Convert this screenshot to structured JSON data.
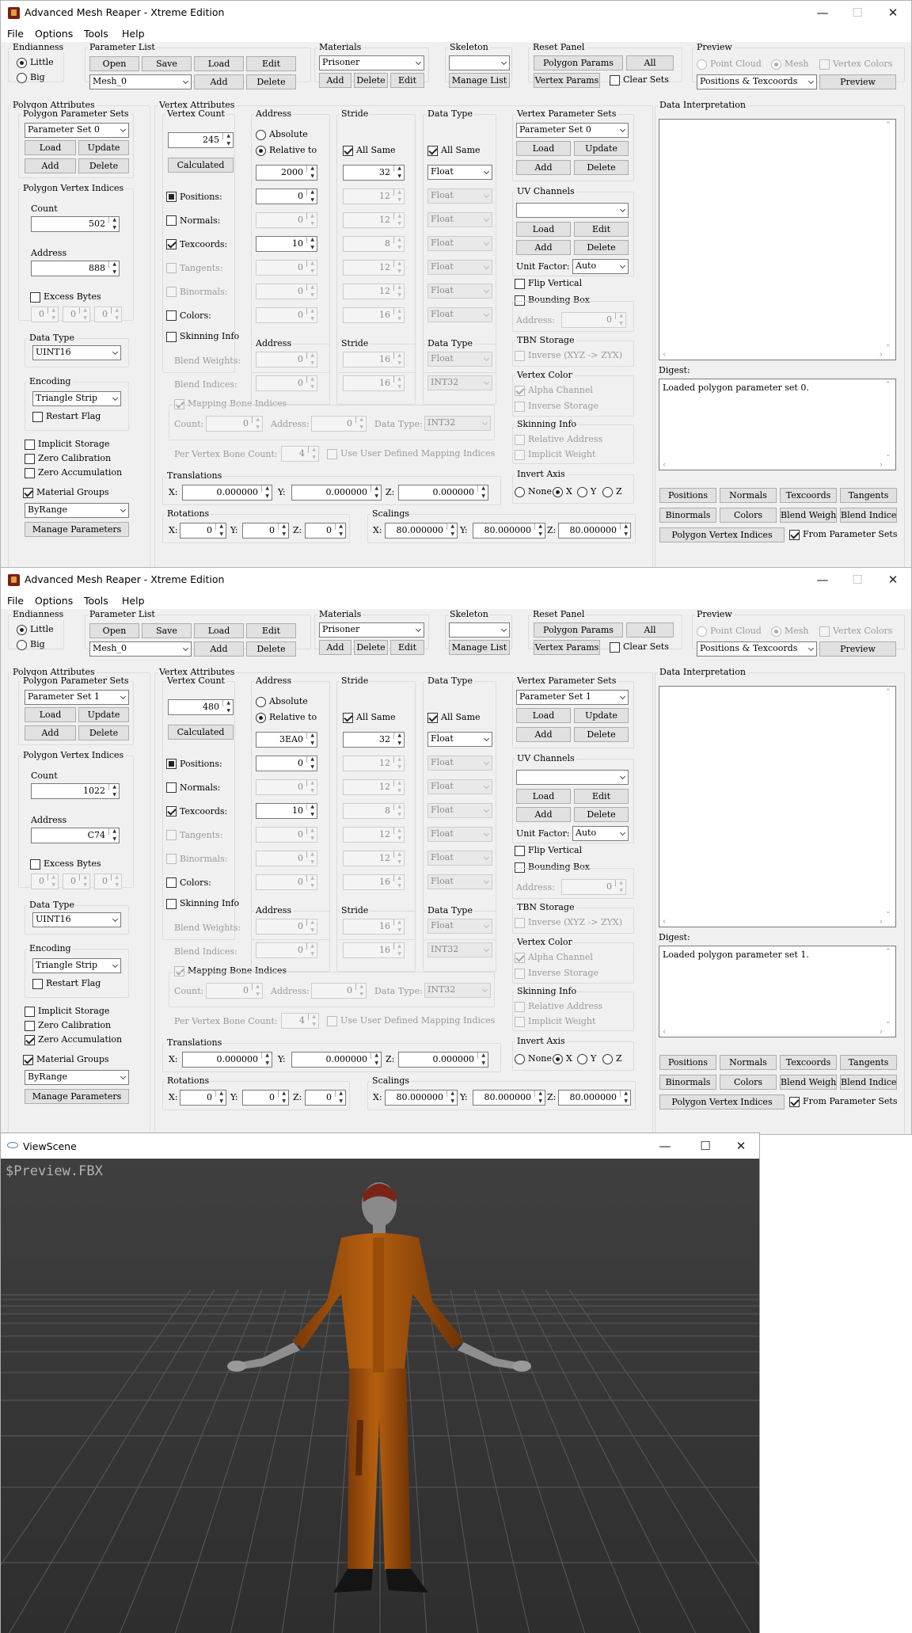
{
  "window1": {
    "title": "Advanced Mesh Reaper - Xtreme Edition",
    "menu": [
      "File",
      "Options",
      "Tools",
      "Help"
    ],
    "endianness": {
      "title": "Endianness",
      "little": "Little",
      "big": "Big"
    },
    "parameter_list": {
      "title": "Parameter List",
      "open": "Open",
      "save": "Save",
      "load": "Load",
      "edit": "Edit",
      "add": "Add",
      "delete": "Delete",
      "mesh": "Mesh_0"
    },
    "materials": {
      "title": "Materials",
      "value": "Prisoner",
      "add": "Add",
      "delete": "Delete",
      "edit": "Edit"
    },
    "skeleton": {
      "title": "Skeleton",
      "value": "",
      "manage": "Manage List"
    },
    "reset_panel": {
      "title": "Reset Panel",
      "polygon_params": "Polygon Params",
      "all": "All",
      "vertex_params": "Vertex Params",
      "clear_sets": "Clear Sets"
    },
    "preview": {
      "title": "Preview",
      "point_cloud": "Point Cloud",
      "mesh": "Mesh",
      "vertex_colors": "Vertex Colors",
      "mode": "Positions & Texcoords",
      "button": "Preview"
    },
    "polygon_attributes": {
      "title": "Polygon Attributes",
      "sets_title": "Polygon Parameter Sets",
      "set_value": "Parameter Set 0",
      "load": "Load",
      "update": "Update",
      "add": "Add",
      "delete": "Delete",
      "pvi_title": "Polygon Vertex Indices",
      "count_label": "Count",
      "count": "502",
      "address_label": "Address",
      "address": "888",
      "excess_bytes": "Excess Bytes",
      "excess": [
        "0",
        "0",
        "0"
      ],
      "data_type_title": "Data Type",
      "data_type": "UINT16",
      "encoding_title": "Encoding",
      "encoding": "Triangle Strip",
      "restart_flag": "Restart Flag",
      "implicit_storage": "Implicit Storage",
      "zero_calibration": "Zero Calibration",
      "zero_accumulation": "Zero Accumulation",
      "material_groups": "Material Groups",
      "group_mode": "ByRange",
      "manage": "Manage Parameters"
    },
    "vertex_attributes": {
      "title": "Vertex Attributes",
      "vertex_count_title": "Vertex Count",
      "vertex_count": "245",
      "calculated": "Calculated",
      "address_title": "Address",
      "absolute": "Absolute",
      "relative_to": "Relative to",
      "relative_value": "2000",
      "stride_title": "Stride",
      "all_same": "All Same",
      "stride_value": "32",
      "data_type_title": "Data Type",
      "data_type_value": "Float",
      "rows": [
        {
          "label": "Positions:",
          "address": "0",
          "stride": "12",
          "type": "Float"
        },
        {
          "label": "Normals:",
          "address": "0",
          "stride": "12",
          "type": "Float"
        },
        {
          "label": "Texcoords:",
          "address": "10",
          "stride": "8",
          "type": "Float"
        },
        {
          "label": "Tangents:",
          "address": "0",
          "stride": "12",
          "type": "Float"
        },
        {
          "label": "Binormals:",
          "address": "0",
          "stride": "12",
          "type": "Float"
        },
        {
          "label": "Colors:",
          "address": "0",
          "stride": "16",
          "type": "Float"
        }
      ],
      "skinning_info": "Skinning Info",
      "blend_weights": {
        "label": "Blend Weights:",
        "address": "0",
        "stride": "16",
        "type": "Float"
      },
      "blend_indices": {
        "label": "Blend Indices:",
        "address": "0",
        "stride": "16",
        "type": "INT32"
      },
      "mapping_bone_indices": "Mapping Bone Indices",
      "mbi_count_label": "Count:",
      "mbi_count": "0",
      "mbi_address_label": "Address:",
      "mbi_address": "0",
      "mbi_type_label": "Data Type:",
      "mbi_type": "INT32",
      "per_vertex_label": "Per Vertex Bone Count:",
      "per_vertex": "4",
      "use_user_defined": "Use User Defined Mapping Indices",
      "translations_title": "Translations",
      "tx": "0.000000",
      "ty": "0.000000",
      "tz": "0.000000",
      "rotations_title": "Rotations",
      "rx": "0",
      "ry": "0",
      "rz": "0",
      "scalings_title": "Scalings",
      "sx": "80.000000",
      "sy": "80.000000",
      "sz": "80.000000",
      "x": "X:",
      "y": "Y:",
      "z": "Z:"
    },
    "vertex_parameter_sets": {
      "title": "Vertex Parameter Sets",
      "value": "Parameter Set 0",
      "load": "Load",
      "update": "Update",
      "add": "Add",
      "delete": "Delete"
    },
    "uv_channels": {
      "title": "UV Channels",
      "load": "Load",
      "edit": "Edit",
      "add": "Add",
      "delete": "Delete",
      "unit_factor_label": "Unit Factor:",
      "unit_factor": "Auto",
      "flip_vertical": "Flip Vertical"
    },
    "bounding_box": {
      "label": "Bounding Box",
      "address_label": "Address:",
      "address": "0"
    },
    "tbn_storage": {
      "title": "TBN Storage",
      "inverse": "Inverse (XYZ -> ZYX)"
    },
    "vertex_color": {
      "title": "Vertex Color",
      "alpha": "Alpha Channel",
      "inverse": "Inverse Storage"
    },
    "skinning_info2": {
      "title": "Skinning Info",
      "relative": "Relative Address",
      "implicit": "Implicit Weight"
    },
    "invert_axis": {
      "title": "Invert Axis",
      "none": "None",
      "x": "X",
      "y": "Y",
      "z": "Z"
    },
    "data_interpretation": {
      "title": "Data Interpretation",
      "digest_label": "Digest:",
      "digest": "Loaded polygon parameter set 0."
    },
    "bottom_buttons": [
      "Positions",
      "Normals",
      "Texcoords",
      "Tangents",
      "Binormals",
      "Colors",
      "Blend Weights",
      "Blend Indices",
      "Polygon Vertex Indices"
    ],
    "from_parameter_sets": "From Parameter Sets"
  },
  "window2": {
    "title": "Advanced Mesh Reaper - Xtreme Edition",
    "set_value": "Parameter Set 1",
    "count": "1022",
    "address": "C74",
    "vertex_count": "480",
    "relative_value": "3EA0",
    "vertex_set_value": "Parameter Set 1",
    "digest": "Loaded polygon parameter set 1."
  },
  "viewscene": {
    "title": "ViewScene",
    "file_label": "$Preview.FBX"
  },
  "colors": {
    "jumpsuit": "#b0580e",
    "grid_bg": "#3b3b3b"
  }
}
